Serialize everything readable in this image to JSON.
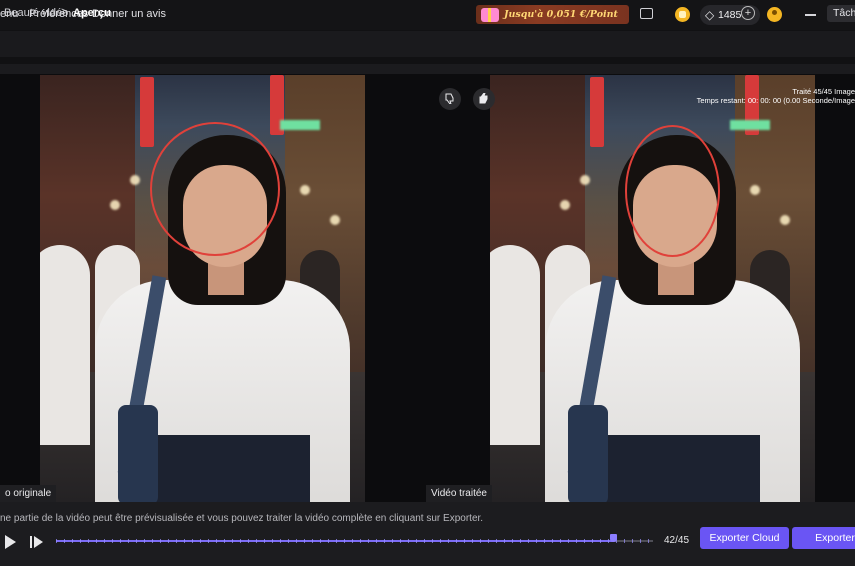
{
  "menu": {
    "items": [
      "enu",
      "Préférences",
      "Donner un avis"
    ]
  },
  "promo": {
    "text": "Jusqu'à 0,051 €/Point"
  },
  "account": {
    "gems": "1485",
    "plus": "+"
  },
  "icons": {
    "chat": "chat-icon",
    "coin": "coin-icon",
    "gem": "diamond-icon",
    "avatar": "user-avatar-icon",
    "minimize": "minimize-icon",
    "maximize": "maximize-icon",
    "thumb_down": "thumbs-down-icon",
    "thumb_up": "thumbs-up-icon",
    "play": "play-icon",
    "step": "step-forward-icon"
  },
  "breadcrumb": {
    "parent": "Beauté vidéo",
    "separator": ">",
    "current": "Aperçu"
  },
  "tasks_button": "Tâche",
  "preview": {
    "processed_line1": "Traité 45/45 Image",
    "processed_line2": "Temps restant: 00: 00: 00 (0.00 Seconde/Image",
    "original_label": "o originale",
    "processed_label": "Vidéo traitée"
  },
  "notice": "ne partie de la vidéo peut être prévisualisée et vous pouvez traiter la vidéo complète en cliquant sur Exporter.",
  "playback": {
    "frame_counter": "42/45",
    "progress": 0.933
  },
  "buttons": {
    "export_cloud": "Exporter Cloud",
    "export": "Exporter"
  },
  "colors": {
    "accent": "#6a55f4",
    "face_outline": "#e0413a",
    "promo_text": "#ffd774"
  }
}
